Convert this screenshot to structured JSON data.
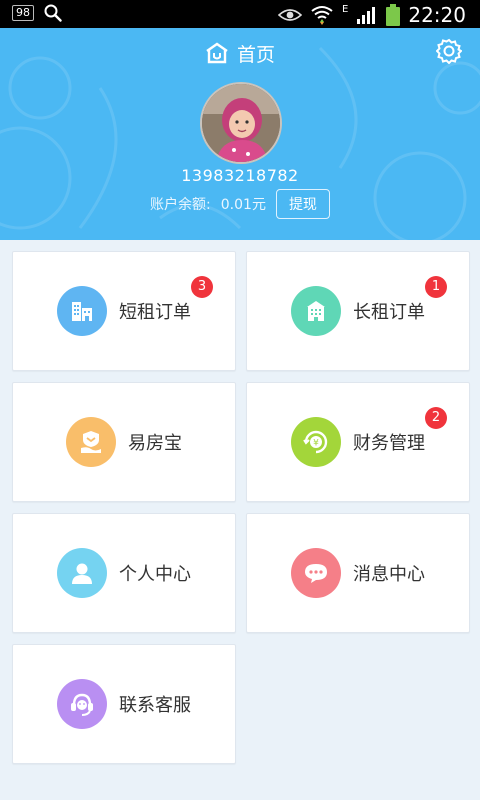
{
  "status_bar": {
    "battery_text": "98",
    "network_label": "E",
    "time": "22:20"
  },
  "header": {
    "title": "首页",
    "phone": "13983218782",
    "balance_label": "账户余额:",
    "balance_value": "0.01元",
    "withdraw_label": "提现"
  },
  "menu": [
    {
      "label": "短租订单",
      "badge": "3",
      "icon": "building-icon",
      "color": "#5fb5f2"
    },
    {
      "label": "长租订单",
      "badge": "1",
      "icon": "apartment-icon",
      "color": "#5fd7b6"
    },
    {
      "label": "易房宝",
      "badge": "",
      "icon": "shield-hand-icon",
      "color": "#f9be6a"
    },
    {
      "label": "财务管理",
      "badge": "2",
      "icon": "yuan-coin-icon",
      "color": "#a3d63a"
    },
    {
      "label": "个人中心",
      "badge": "",
      "icon": "person-icon",
      "color": "#75d3f1"
    },
    {
      "label": "消息中心",
      "badge": "",
      "icon": "chat-bubble-icon",
      "color": "#f57f88"
    },
    {
      "label": "联系客服",
      "badge": "",
      "icon": "headset-icon",
      "color": "#b98ff2"
    }
  ],
  "colors": {
    "header_bg": "#4bb8f3",
    "page_bg": "#eaf2f9",
    "badge": "#f0343c"
  }
}
